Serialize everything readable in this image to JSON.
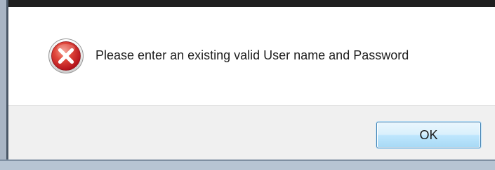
{
  "dialog": {
    "icon": "error-icon",
    "message": "Please enter an existing valid User name and Password",
    "ok_label": "OK"
  },
  "colors": {
    "error_red": "#d8252b",
    "button_border": "#3c7fb1",
    "button_strip": "#f0f0f0"
  }
}
